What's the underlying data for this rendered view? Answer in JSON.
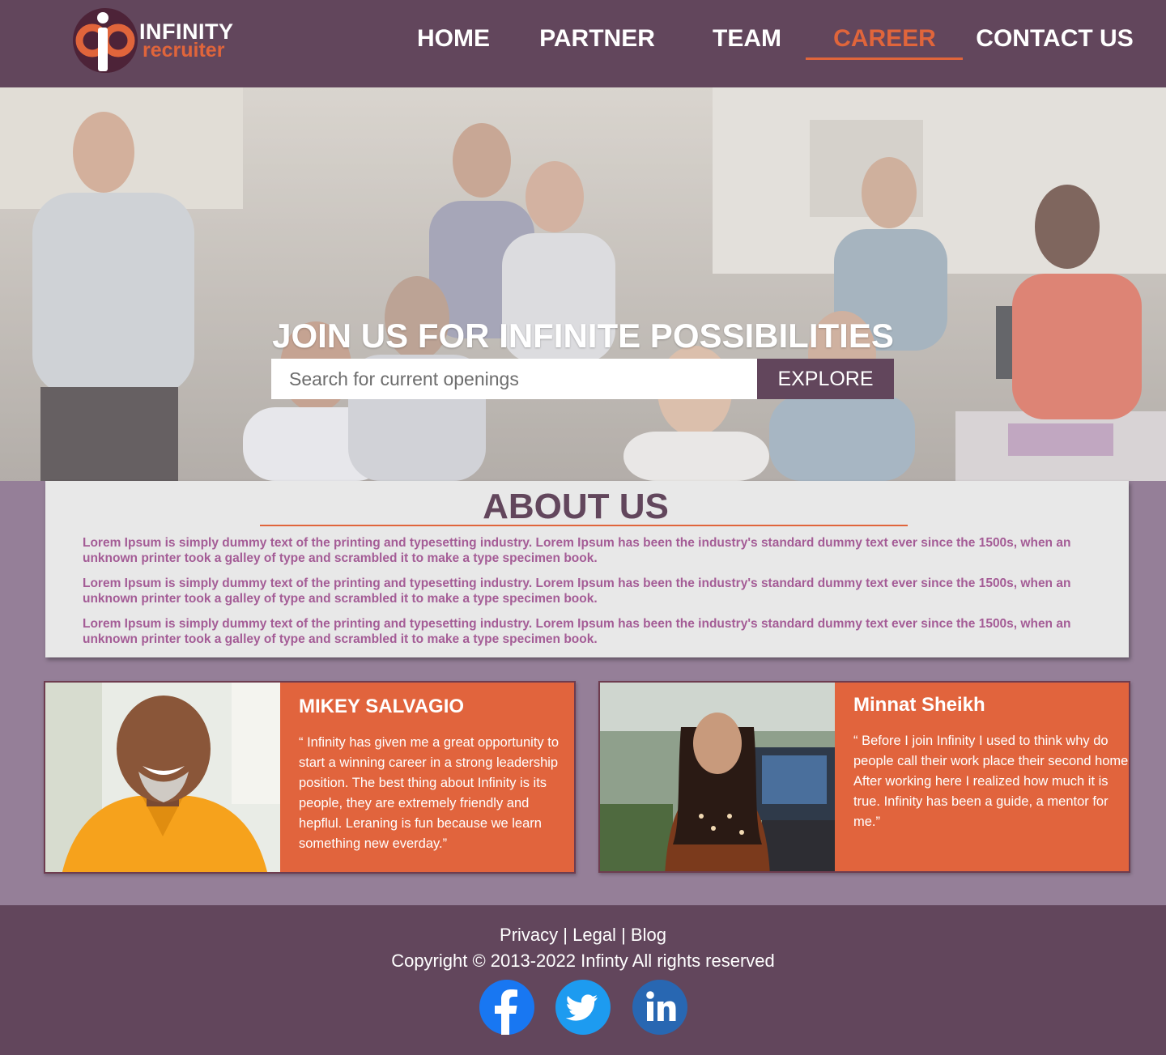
{
  "brand": {
    "name_line1": "INFINITY",
    "name_line2": "recruiter",
    "colors": {
      "primary": "#62465c",
      "accent": "#e0653b",
      "page_bg": "#957f98"
    }
  },
  "nav": {
    "items": [
      {
        "label": "HOME"
      },
      {
        "label": "PARTNER"
      },
      {
        "label": "TEAM"
      },
      {
        "label": "CAREER",
        "active": true
      },
      {
        "label": "CONTACT US"
      }
    ]
  },
  "hero": {
    "title": "JOIN US FOR INFINITE POSSIBILITIES",
    "search_placeholder": "Search for current openings",
    "search_value": "",
    "button_label": "EXPLORE"
  },
  "about": {
    "title": "ABOUT US",
    "paragraphs": [
      "Lorem Ipsum is simply dummy text of the printing and typesetting industry. Lorem Ipsum has been the industry's standard dummy text ever since the 1500s, when an unknown printer took a galley of type and scrambled it to make a type specimen book.",
      "Lorem Ipsum is simply dummy text of the printing and typesetting industry. Lorem Ipsum has been the industry's standard dummy text ever since the 1500s, when an unknown printer took a galley of type and scrambled it to make a type specimen book.",
      "Lorem Ipsum is simply dummy text of the printing and typesetting industry. Lorem Ipsum has been the industry's standard dummy text ever since the 1500s, when an unknown printer took a galley of type and scrambled it to make a type specimen book."
    ]
  },
  "testimonials": [
    {
      "name": "MIKEY SALVAGIO",
      "quote": "“ Infinity has given me a great opportunity to start a winning career in a strong leadership position. The best thing about Infinity is its people, they are extremely friendly and hepflul. Leraning is fun because we learn something  new everday.”"
    },
    {
      "name": "Minnat Sheikh",
      "quote": "“ Before I join Infinity I used to think why do people call their work place their second home After working here I realized how much it is true. Infinity has been a guide, a mentor for me.”"
    }
  ],
  "footer": {
    "links": [
      "Privacy",
      "Legal",
      "Blog"
    ],
    "separator": "|",
    "copyright": "Copyright © 2013-2022 Infinty All rights reserved",
    "social": [
      {
        "icon": "facebook-icon",
        "color": "#1877f2"
      },
      {
        "icon": "twitter-icon",
        "color": "#1d9bf0"
      },
      {
        "icon": "linkedin-icon",
        "color": "#2867b2"
      }
    ]
  }
}
